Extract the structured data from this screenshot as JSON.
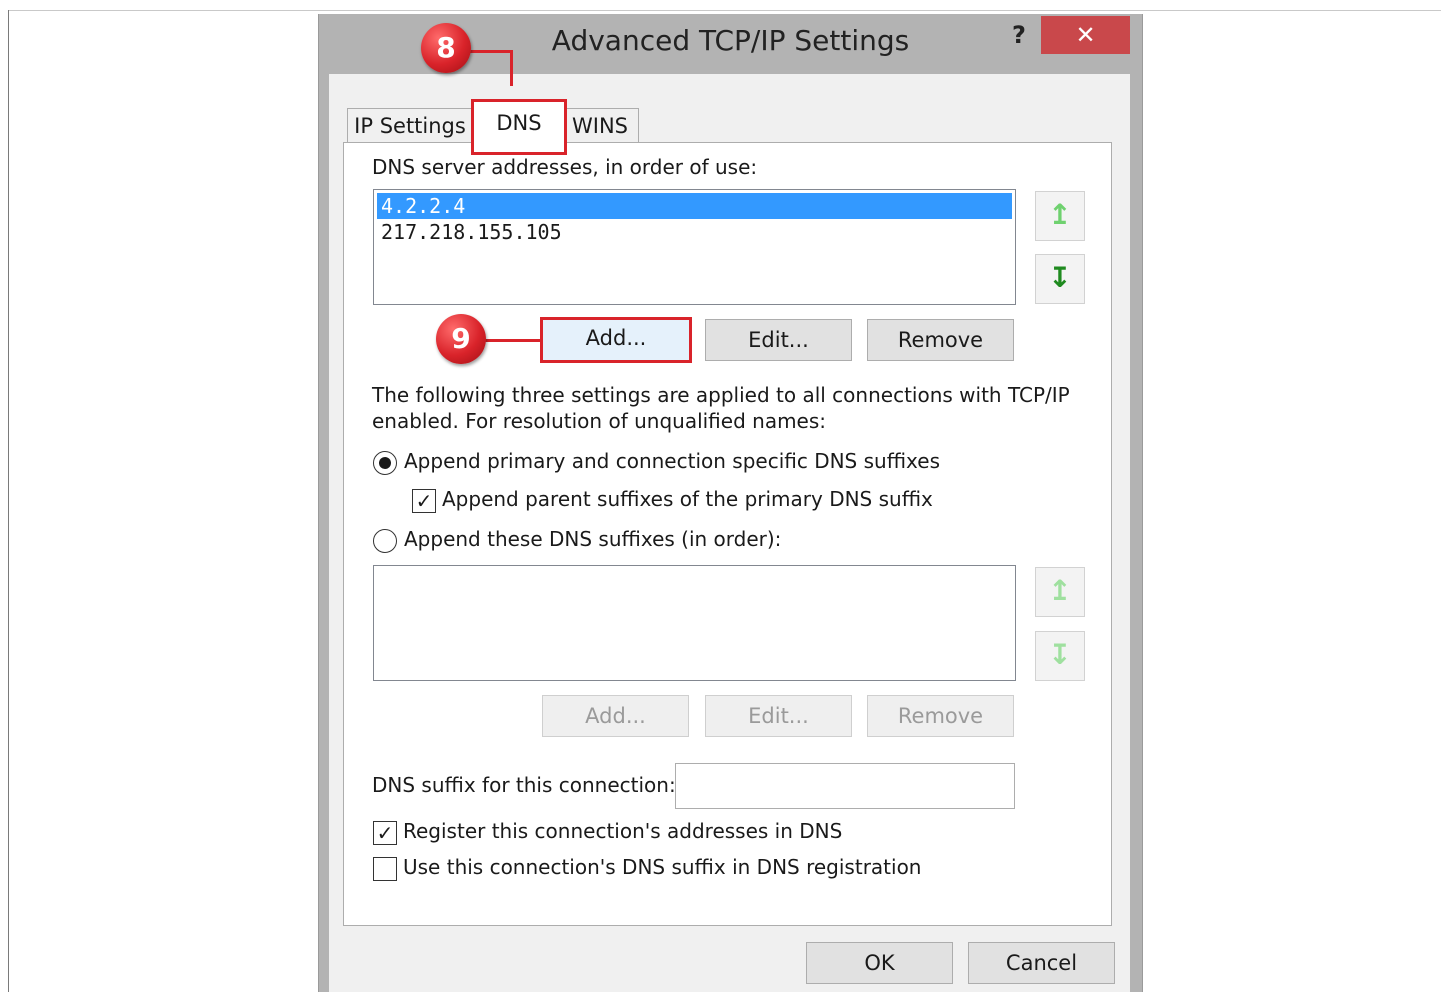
{
  "dialog": {
    "title": "Advanced TCP/IP Settings",
    "help_label": "?",
    "close_label": "✕"
  },
  "tabs": [
    {
      "label": "IP Settings",
      "active": false
    },
    {
      "label": "DNS",
      "active": true
    },
    {
      "label": "WINS",
      "active": false
    }
  ],
  "dns_servers": {
    "label": "DNS server addresses, in order of use:",
    "items": [
      "4.2.2.4",
      "217.218.155.105"
    ],
    "selected_index": 0,
    "up_icon": "↥",
    "down_icon": "↧",
    "add_label": "Add...",
    "edit_label": "Edit...",
    "remove_label": "Remove"
  },
  "info_text": {
    "line1": "The following three settings are applied to all connections with TCP/IP",
    "line2": "enabled. For resolution of unqualified names:"
  },
  "options": {
    "append_primary_label": "Append primary and connection specific DNS suffixes",
    "append_primary_checked": true,
    "append_parent_label": "Append parent suffixes of the primary DNS suffix",
    "append_parent_checked": true,
    "append_these_label": "Append these DNS suffixes (in order):",
    "append_these_checked": false
  },
  "suffix_list": {
    "items": [],
    "add_label": "Add...",
    "edit_label": "Edit...",
    "remove_label": "Remove"
  },
  "connection_suffix": {
    "label": "DNS suffix for this connection:",
    "value": ""
  },
  "register": {
    "label": "Register this connection's addresses in DNS",
    "checked": true
  },
  "use_suffix": {
    "label": "Use this connection's DNS suffix in DNS registration",
    "checked": false
  },
  "footer": {
    "ok_label": "OK",
    "cancel_label": "Cancel"
  },
  "callouts": {
    "step_tab": "8",
    "step_add": "9"
  },
  "colors": {
    "highlight_red": "#d9232a",
    "selection_blue": "#3399ff",
    "close_red": "#c9484b"
  }
}
